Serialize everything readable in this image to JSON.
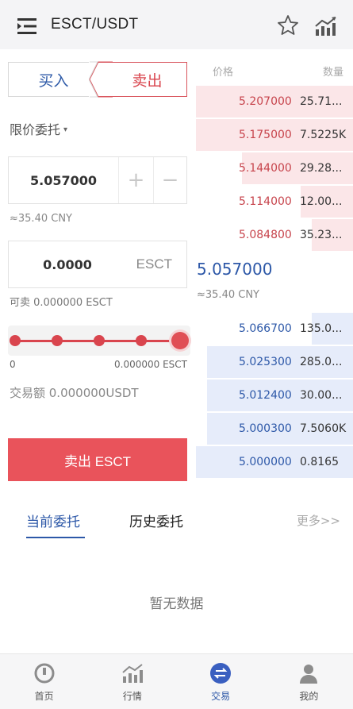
{
  "header": {
    "pair": "ESCT/USDT",
    "icons": [
      "menu-icon",
      "star-icon",
      "chart-icon"
    ]
  },
  "trade": {
    "buy_tab": "买入",
    "sell_tab": "卖出",
    "order_type": "限价委托",
    "order_type_caret": "▾",
    "price": "5.057000",
    "plus": "+",
    "minus": "−",
    "price_cny": "≈35.40 CNY",
    "quantity": "0.0000",
    "quantity_unit": "ESCT",
    "available": "可卖 0.000000 ESCT",
    "slider_min": "0",
    "slider_max": "0.000000 ESCT",
    "slider_level": 1.0,
    "trade_amount": "交易额 0.000000USDT",
    "sell_button": "卖出 ESCT"
  },
  "orderbook": {
    "price_header": "价格",
    "qty_header": "数量",
    "asks": [
      {
        "price": "5.207000",
        "qty": "25.71..."
      },
      {
        "price": "5.175000",
        "qty": "7.5225K"
      },
      {
        "price": "5.144000",
        "qty": "29.28..."
      },
      {
        "price": "5.114000",
        "qty": "12.00..."
      },
      {
        "price": "5.084800",
        "qty": "35.23..."
      }
    ],
    "last_price": "5.057000",
    "last_cny": "≈35.40 CNY",
    "bids": [
      {
        "price": "5.066700",
        "qty": "135.0..."
      },
      {
        "price": "5.025300",
        "qty": "285.0..."
      },
      {
        "price": "5.012400",
        "qty": "30.00..."
      },
      {
        "price": "5.000300",
        "qty": "7.5060K"
      },
      {
        "price": "5.000000",
        "qty": "0.8165"
      }
    ],
    "colors": {
      "ask": "#c7444c",
      "bid": "#2d58a8",
      "ask_bg": "#fbe6e8",
      "bid_bg": "#e6ecfa"
    }
  },
  "orders": {
    "tab_current": "当前委托",
    "tab_history": "历史委托",
    "more": "更多>>",
    "empty": "暂无数据"
  },
  "nav": [
    {
      "label": "首页",
      "icon": "home-icon"
    },
    {
      "label": "行情",
      "icon": "market-icon"
    },
    {
      "label": "交易",
      "icon": "trade-icon",
      "active": true
    },
    {
      "label": "我的",
      "icon": "profile-icon"
    }
  ]
}
